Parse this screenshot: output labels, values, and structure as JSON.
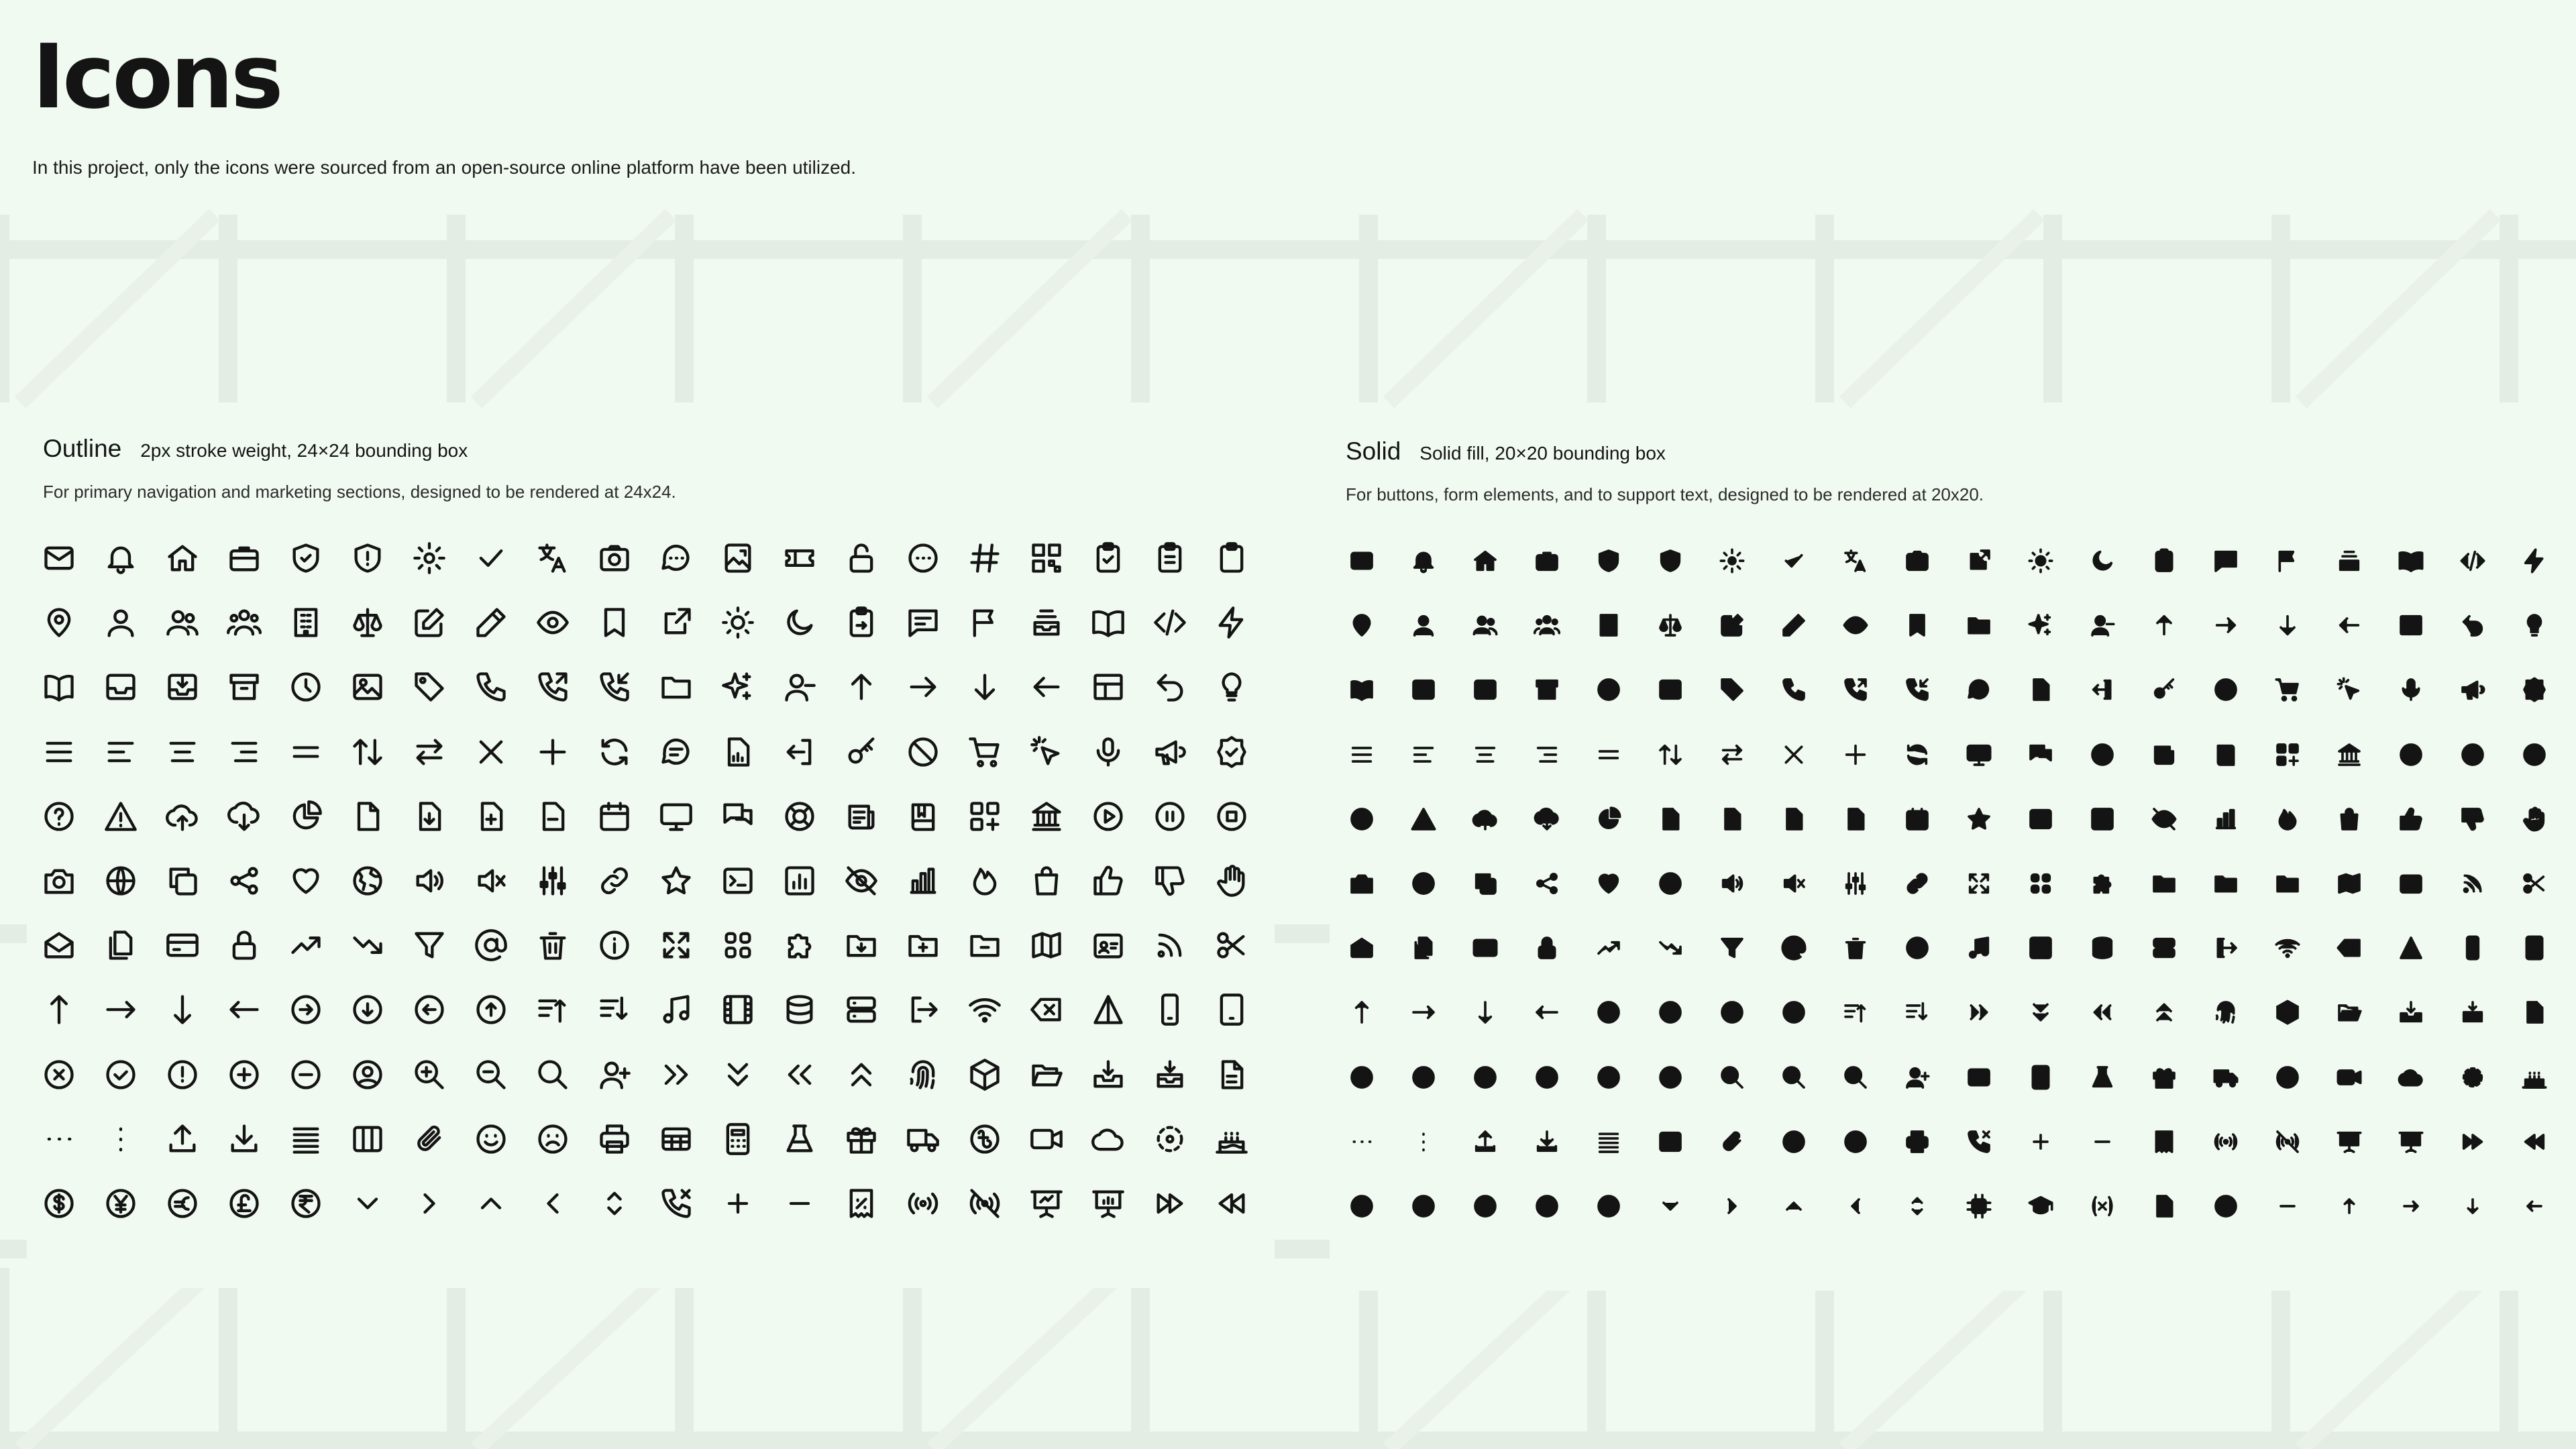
{
  "page": {
    "title": "Icons",
    "subtitle": "In this project, only the icons were sourced from an open-source online platform have been utilized."
  },
  "colors": {
    "background": "#f1faf1",
    "pattern": "#e3ede3",
    "ink": "#141414"
  },
  "sections": [
    {
      "name": "Outline",
      "spec": "2px stroke weight, 24×24 bounding box",
      "description": "For primary navigation and marketing sections, designed to be rendered at 24x24.",
      "style": "outline",
      "icon_rows": [
        [
          "envelope-icon",
          "bell-icon",
          "home-icon",
          "briefcase-icon",
          "shield-check-icon",
          "shield-exclamation-icon",
          "cog-icon",
          "check-icon",
          "language-icon",
          "camera-icon",
          "chat-dots-icon",
          "photo-export-icon",
          "ticket-icon",
          "lock-open-icon",
          "ellipsis-circle-icon",
          "hashtag-icon",
          "qr-code-icon",
          "clipboard-check-icon",
          "clipboard-list-icon",
          "clipboard-icon"
        ],
        [
          "map-pin-icon",
          "user-icon",
          "users-icon",
          "user-group-icon",
          "building-icon",
          "scale-icon",
          "pencil-square-icon",
          "pencil-icon",
          "eye-icon",
          "bookmark-icon",
          "external-link-icon",
          "sun-icon",
          "moon-icon",
          "clipboard-copy-icon",
          "chat-text-icon",
          "flag-icon",
          "inbox-stack-icon",
          "book-open-icon",
          "code-icon",
          "bolt-icon"
        ],
        [
          "book-open-half-icon",
          "inbox-icon",
          "inbox-arrow-icon",
          "archive-icon",
          "clock-icon",
          "photo-icon",
          "tag-icon",
          "phone-icon",
          "phone-outgoing-icon",
          "phone-incoming-icon",
          "folder-icon",
          "sparkles-icon",
          "user-minus-icon",
          "arrow-up-icon",
          "arrow-right-icon",
          "arrow-down-icon",
          "arrow-left-icon",
          "layout-icon",
          "arrow-uturn-left-icon",
          "light-bulb-icon"
        ],
        [
          "menu-icon",
          "align-left-icon",
          "align-center-icon",
          "align-right-icon",
          "equals-icon",
          "arrows-up-down-icon",
          "arrows-right-left-icon",
          "x-mark-icon",
          "plus-icon",
          "refresh-icon",
          "chat-lines-icon",
          "document-chart-icon",
          "arrow-left-on-rect-icon",
          "key-icon",
          "no-symbol-icon",
          "shopping-cart-icon",
          "cursor-click-icon",
          "microphone-icon",
          "megaphone-icon",
          "check-badge-icon"
        ],
        [
          "question-circle-icon",
          "warning-icon",
          "cloud-upload-icon",
          "cloud-download-icon",
          "chart-pie-icon",
          "document-icon",
          "document-arrow-down-icon",
          "document-plus-icon",
          "document-minus-icon",
          "calendar-icon",
          "monitor-icon",
          "chats-icon",
          "lifebuoy-icon",
          "newspaper-icon",
          "book-icon",
          "squares-plus-icon",
          "bank-icon",
          "play-circle-icon",
          "pause-circle-icon",
          "stop-circle-icon"
        ],
        [
          "camera-photo-icon",
          "globe-icon",
          "copy-icon",
          "share-icon",
          "heart-icon",
          "globe-americas-icon",
          "speaker-wave-icon",
          "speaker-mute-icon",
          "sliders-icon",
          "link-icon",
          "star-icon",
          "terminal-icon",
          "bar-chart-square-icon",
          "eye-slash-icon",
          "chart-bar-icon",
          "fire-icon",
          "shopping-bag-icon",
          "thumb-up-icon",
          "thumb-down-icon",
          "hand-icon"
        ],
        [
          "envelope-open-icon",
          "documents-icon",
          "credit-card-icon",
          "lock-closed-icon",
          "trending-up-icon",
          "trending-down-icon",
          "filter-icon",
          "at-icon",
          "trash-icon",
          "info-circle-icon",
          "arrows-expand-icon",
          "grid-icon",
          "puzzle-icon",
          "folder-down-icon",
          "folder-plus-icon",
          "folder-minus-icon",
          "map-icon",
          "id-card-icon",
          "rss-icon",
          "scissors-icon"
        ],
        [
          "arrow-long-up-icon",
          "arrow-long-right-icon",
          "arrow-long-down-icon",
          "arrow-long-left-icon",
          "arrow-right-circle-icon",
          "arrow-down-circle-icon",
          "arrow-left-circle-icon",
          "arrow-up-circle-icon",
          "sort-up-icon",
          "sort-down-icon",
          "music-note-icon",
          "film-icon",
          "database-icon",
          "server-icon",
          "logout-icon",
          "wifi-icon",
          "backspace-icon",
          "triangle-icon",
          "mobile-icon",
          "tablet-icon"
        ],
        [
          "x-circle-icon",
          "check-circle-icon",
          "exclamation-circle-icon",
          "plus-circle-icon",
          "minus-circle-icon",
          "user-circle-icon",
          "zoom-in-icon",
          "zoom-out-icon",
          "search-icon",
          "user-plus-icon",
          "chevron-double-right-icon",
          "chevron-double-down-icon",
          "chevron-double-left-icon",
          "chevron-double-up-icon",
          "fingerprint-icon",
          "cube-icon",
          "folder-open-icon",
          "inbox-download-icon",
          "inbox-stack-down-icon",
          "document-text-icon"
        ],
        [
          "ellipsis-horizontal-icon",
          "ellipsis-vertical-icon",
          "upload-icon",
          "download-icon",
          "queue-list-icon",
          "columns-icon",
          "paper-clip-icon",
          "face-smile-icon",
          "face-frown-icon",
          "printer-icon",
          "table-icon",
          "calculator-icon",
          "beaker-icon",
          "gift-icon",
          "truck-icon",
          "currency-bangladeshi-icon",
          "video-camera-icon",
          "cloud-icon",
          "viewfinder-icon",
          "cake-icon"
        ],
        [
          "dollar-icon",
          "yen-icon",
          "euro-icon",
          "pound-icon",
          "rupee-icon",
          "chevron-down-icon",
          "chevron-right-icon",
          "chevron-up-icon",
          "chevron-left-icon",
          "chevron-up-down-icon",
          "phone-x-icon",
          "plus-small-icon",
          "minus-small-icon",
          "receipt-percent-icon",
          "signal-icon",
          "signal-slash-icon",
          "presentation-chart-icon",
          "presentation-bar-icon",
          "forward-icon",
          "backward-icon"
        ]
      ]
    },
    {
      "name": "Solid",
      "spec": "Solid fill, 20×20 bounding box",
      "description": "For buttons, form elements, and to support text, designed to be rendered at 20x20.",
      "style": "solid",
      "icon_rows": [
        [
          "envelope-icon",
          "bell-icon",
          "home-icon",
          "briefcase-icon",
          "shield-check-icon",
          "shield-exclamation-icon",
          "cog-icon",
          "check-icon",
          "language-icon",
          "camera-icon",
          "external-link-icon",
          "sun-icon",
          "moon-icon",
          "clipboard-copy-icon",
          "chat-text-icon",
          "flag-icon",
          "inbox-stack-icon",
          "book-open-icon",
          "code-icon",
          "bolt-icon"
        ],
        [
          "map-pin-icon",
          "user-icon",
          "users-icon",
          "user-group-icon",
          "building-icon",
          "scale-icon",
          "pencil-square-icon",
          "pencil-icon",
          "eye-icon",
          "bookmark-icon",
          "folder-icon",
          "sparkles-icon",
          "user-minus-icon",
          "arrow-up-icon",
          "arrow-right-icon",
          "arrow-down-icon",
          "arrow-left-icon",
          "layout-icon",
          "arrow-uturn-left-icon",
          "light-bulb-icon"
        ],
        [
          "book-open-half-icon",
          "inbox-icon",
          "inbox-arrow-icon",
          "archive-icon",
          "clock-icon",
          "photo-icon",
          "tag-icon",
          "phone-icon",
          "phone-outgoing-icon",
          "phone-incoming-icon",
          "chat-lines-icon",
          "document-chart-icon",
          "arrow-left-on-rect-icon",
          "key-icon",
          "no-symbol-icon",
          "shopping-cart-icon",
          "cursor-click-icon",
          "microphone-icon",
          "megaphone-icon",
          "check-badge-icon"
        ],
        [
          "menu-icon",
          "align-left-icon",
          "align-center-icon",
          "align-right-icon",
          "equals-icon",
          "arrows-up-down-icon",
          "arrows-right-left-icon",
          "x-mark-icon",
          "plus-icon",
          "refresh-icon",
          "monitor-icon",
          "chats-icon",
          "lifebuoy-icon",
          "newspaper-icon",
          "book-icon",
          "squares-plus-icon",
          "bank-icon",
          "play-circle-icon",
          "pause-circle-icon",
          "stop-circle-icon"
        ],
        [
          "question-circle-icon",
          "warning-icon",
          "cloud-upload-icon",
          "cloud-download-icon",
          "chart-pie-icon",
          "document-icon",
          "document-arrow-down-icon",
          "document-plus-icon",
          "document-minus-icon",
          "calendar-icon",
          "star-icon",
          "terminal-icon",
          "bar-chart-square-icon",
          "eye-slash-icon",
          "chart-bar-icon",
          "fire-icon",
          "shopping-bag-icon",
          "thumb-up-icon",
          "thumb-down-icon",
          "hand-icon"
        ],
        [
          "camera-photo-icon",
          "globe-icon",
          "copy-icon",
          "share-icon",
          "heart-icon",
          "globe-americas-icon",
          "speaker-wave-icon",
          "speaker-mute-icon",
          "sliders-icon",
          "link-icon",
          "arrows-expand-icon",
          "grid-icon",
          "puzzle-icon",
          "folder-down-icon",
          "folder-plus-icon",
          "folder-minus-icon",
          "map-icon",
          "id-card-icon",
          "rss-icon",
          "scissors-icon"
        ],
        [
          "envelope-open-icon",
          "documents-icon",
          "credit-card-icon",
          "lock-closed-icon",
          "trending-up-icon",
          "trending-down-icon",
          "filter-icon",
          "at-icon",
          "trash-icon",
          "info-circle-icon",
          "music-note-icon",
          "film-icon",
          "database-icon",
          "server-icon",
          "logout-icon",
          "wifi-icon",
          "backspace-icon",
          "triangle-icon",
          "mobile-icon",
          "tablet-icon"
        ],
        [
          "arrow-long-up-icon",
          "arrow-long-right-icon",
          "arrow-long-down-icon",
          "arrow-long-left-icon",
          "arrow-right-circle-icon",
          "arrow-down-circle-icon",
          "arrow-left-circle-icon",
          "arrow-up-circle-icon",
          "sort-up-icon",
          "sort-down-icon",
          "chevron-double-right-icon",
          "chevron-double-down-icon",
          "chevron-double-left-icon",
          "chevron-double-up-icon",
          "fingerprint-icon",
          "cube-icon",
          "folder-open-icon",
          "inbox-download-icon",
          "inbox-stack-down-icon",
          "document-text-icon"
        ],
        [
          "x-circle-icon",
          "check-circle-icon",
          "exclamation-circle-icon",
          "plus-circle-icon",
          "minus-circle-icon",
          "user-circle-icon",
          "zoom-in-icon",
          "zoom-out-icon",
          "search-icon",
          "user-plus-icon",
          "table-icon",
          "calculator-icon",
          "beaker-icon",
          "gift-icon",
          "truck-icon",
          "currency-bangladeshi-icon",
          "video-camera-icon",
          "cloud-icon",
          "viewfinder-icon",
          "cake-icon"
        ],
        [
          "ellipsis-horizontal-icon",
          "ellipsis-vertical-icon",
          "upload-icon",
          "download-icon",
          "queue-list-icon",
          "columns-icon",
          "paper-clip-icon",
          "face-smile-icon",
          "face-frown-icon",
          "printer-icon",
          "phone-x-icon",
          "plus-small-icon",
          "minus-small-icon",
          "receipt-percent-icon",
          "signal-icon",
          "signal-slash-icon",
          "presentation-chart-icon",
          "presentation-bar-icon",
          "forward-icon",
          "backward-icon"
        ],
        [
          "dollar-icon",
          "yen-icon",
          "euro-icon",
          "pound-icon",
          "rupee-icon",
          "chevron-down-icon",
          "chevron-right-icon",
          "chevron-up-icon",
          "chevron-left-icon",
          "chevron-up-down-icon",
          "cpu-chip-icon",
          "academic-cap-icon",
          "variable-icon",
          "document-magnify-icon",
          "magnify-circle-icon",
          "minus-small-icon",
          "arrow-small-up-icon",
          "arrow-small-right-icon",
          "arrow-small-down-icon",
          "arrow-small-left-icon"
        ]
      ]
    }
  ]
}
